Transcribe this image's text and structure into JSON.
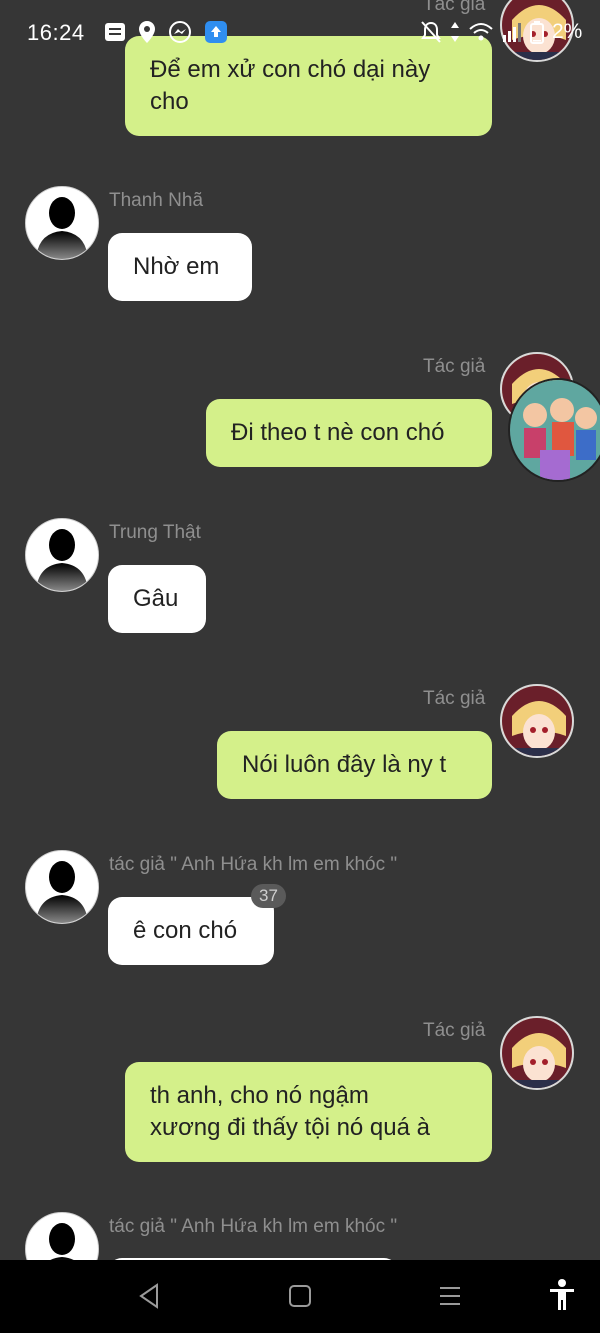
{
  "status_bar": {
    "time": "16:24",
    "battery": "2%",
    "icons_left": [
      "notes-icon",
      "location-pin-icon",
      "messenger-icon",
      "upload-app-icon"
    ],
    "icons_right": [
      "bell-muted-icon",
      "data-arrows-icon",
      "wifi-icon",
      "signal-icon",
      "battery-icon"
    ]
  },
  "messages": [
    {
      "side": "out",
      "author": "Tác giả",
      "text": "Để em xử con chó dại này\ncho"
    },
    {
      "side": "in",
      "author": "Thanh Nhã",
      "text": "Nhờ em"
    },
    {
      "side": "out",
      "author": "Tác giả",
      "text": "Đi theo t nè con chó"
    },
    {
      "side": "in",
      "author": "Trung Thật",
      "text": "Gâu"
    },
    {
      "side": "out",
      "author": "Tác giả",
      "text": "Nói luôn đây là ny t"
    },
    {
      "side": "in",
      "author": "tác giả \" Anh Hứa kh lm em khóc \"",
      "text": "ê con chó",
      "badge": "37"
    },
    {
      "side": "out",
      "author": "Tác giả",
      "text": "th anh, cho nó ngậm\nxương đi thấy tội nó quá à"
    },
    {
      "side": "in",
      "author": "tác giả \" Anh Hứa kh lm em khóc \"",
      "text": ""
    }
  ],
  "nav": [
    "back-icon",
    "home-icon",
    "menu-icon",
    "accessibility-icon"
  ],
  "colors": {
    "background": "#363636",
    "out_bubble": "#d4f08a",
    "in_bubble": "#ffffff",
    "name_text": "#8f8f8f"
  }
}
